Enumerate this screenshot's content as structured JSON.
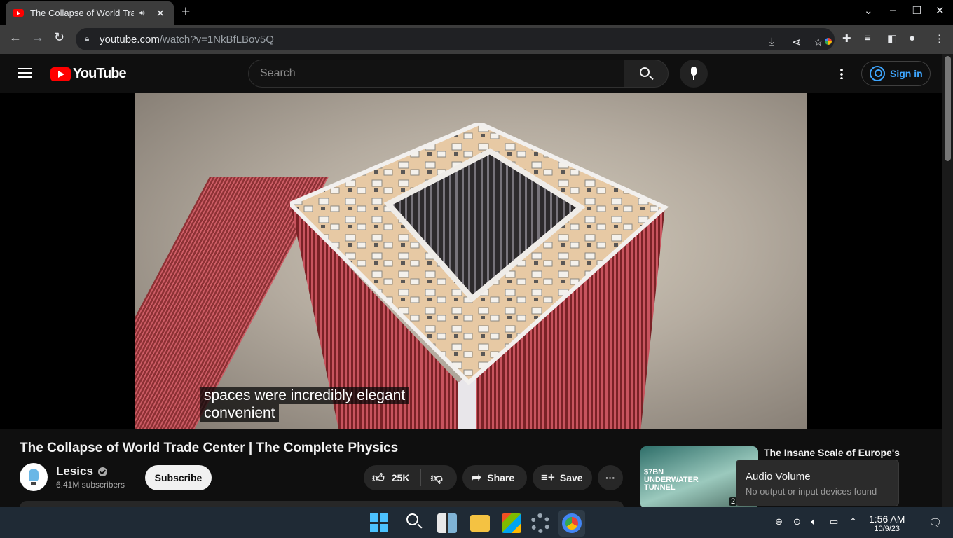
{
  "browser": {
    "tab_title": "The Collapse of World Trade Center | The Complete Physics",
    "url_domain": "youtube.com",
    "url_path": "/watch?v=1NkBfLBov5Q"
  },
  "youtube": {
    "logo_text": "YouTube",
    "search_placeholder": "Search",
    "signin_label": "Sign in"
  },
  "video": {
    "caption_line1": "spaces were incredibly elegant",
    "caption_line2": "convenient",
    "title": "The Collapse of World Trade Center | The Complete Physics"
  },
  "channel": {
    "name": "Lesics",
    "subscribers": "6.41M subscribers",
    "subscribe_label": "Subscribe"
  },
  "actions": {
    "like_count": "25K",
    "share_label": "Share",
    "save_label": "Save"
  },
  "related": {
    "title": "The Insane Scale of Europe's",
    "thumb_line1": "$7BN",
    "thumb_line2": "UNDERWATER",
    "thumb_line3": "TUNNEL",
    "duration_partial": "2"
  },
  "audio_flyout": {
    "title": "Audio Volume",
    "subtitle": "No output or input devices found"
  },
  "taskbar": {
    "time": "1:56 AM",
    "date": "10/9/23"
  },
  "colors": {
    "youtube_red": "#ff0000",
    "link_blue": "#3ea6ff"
  }
}
